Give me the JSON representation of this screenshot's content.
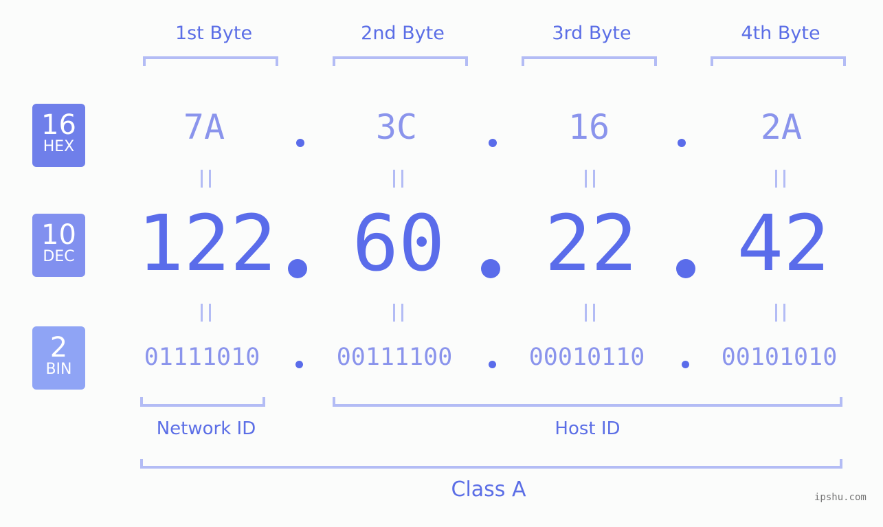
{
  "ip": {
    "decimal": "122.60.22.42",
    "bytes": [
      {
        "label": "1st Byte",
        "hex": "7A",
        "dec": "122",
        "bin": "01111010"
      },
      {
        "label": "2nd Byte",
        "hex": "3C",
        "dec": "60",
        "bin": "00111100"
      },
      {
        "label": "3rd Byte",
        "hex": "16",
        "dec": "22",
        "bin": "00010110"
      },
      {
        "label": "4th Byte",
        "hex": "2A",
        "dec": "42",
        "bin": "00101010"
      }
    ]
  },
  "badges": [
    {
      "base": "16",
      "name": "HEX",
      "color": "#6f7fea"
    },
    {
      "base": "10",
      "name": "DEC",
      "color": "#8190ef"
    },
    {
      "base": "2",
      "name": "BIN",
      "color": "#8fa4f5"
    }
  ],
  "sections": {
    "network": "Network ID",
    "host": "Host ID",
    "class": "Class A"
  },
  "colors": {
    "primary": "#5a6cea",
    "light": "#8a94ec",
    "bracket": "#b3bcf5"
  },
  "watermark": "ipshu.com"
}
